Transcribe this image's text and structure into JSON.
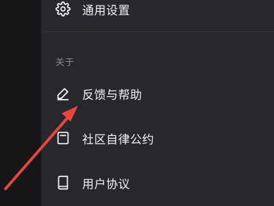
{
  "settings_menu": {
    "general": {
      "icon": "gear-icon",
      "label": "通用设置"
    },
    "about_section": {
      "header": "关于",
      "items": [
        {
          "icon": "pencil-icon",
          "label": "反馈与帮助"
        },
        {
          "icon": "document-icon",
          "label": "社区自律公约"
        },
        {
          "icon": "book-icon",
          "label": "用户协议"
        }
      ]
    }
  },
  "annotation": {
    "arrow_color": "#e8463b"
  },
  "colors": {
    "background": "#27282d",
    "left_strip": "#161618",
    "text_primary": "#f2f2f2",
    "text_secondary": "#8a8b90"
  }
}
